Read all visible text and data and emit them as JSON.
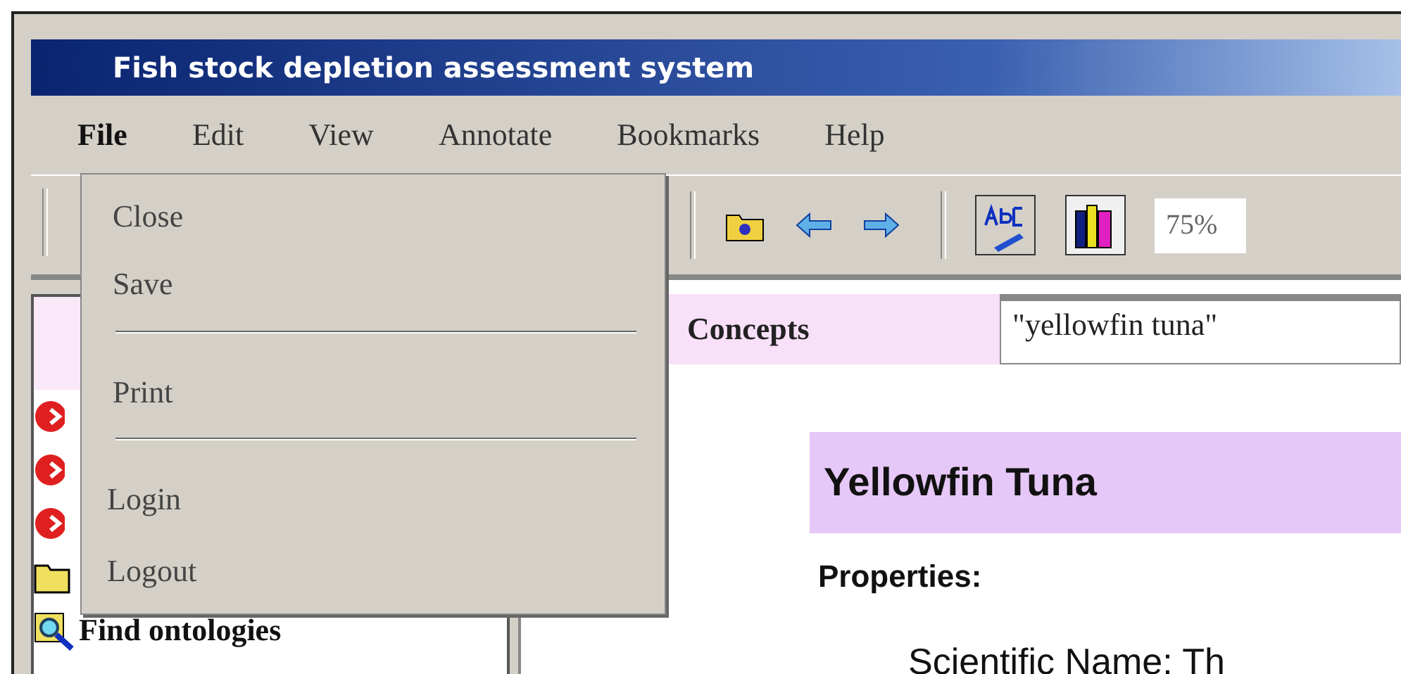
{
  "window": {
    "title": "Fish stock depletion assessment system"
  },
  "menu_bar": [
    {
      "label": "File",
      "open": true
    },
    {
      "label": "Edit",
      "open": false
    },
    {
      "label": "View",
      "open": false
    },
    {
      "label": "Annotate",
      "open": false
    },
    {
      "label": "Bookmarks",
      "open": false
    },
    {
      "label": "Help",
      "open": false
    }
  ],
  "file_menu": [
    {
      "kind": "item",
      "label": "Close"
    },
    {
      "kind": "item",
      "label": "Save"
    },
    {
      "kind": "separator"
    },
    {
      "kind": "item",
      "label": "Print"
    },
    {
      "kind": "separator"
    },
    {
      "kind": "item",
      "label": "Login"
    },
    {
      "kind": "item",
      "label": "Logout"
    }
  ],
  "toolbar": {
    "zoom": "75%"
  },
  "sidebar": {
    "items": [
      {
        "kind": "concept"
      },
      {
        "kind": "concept"
      },
      {
        "kind": "concept"
      },
      {
        "kind": "folder"
      },
      {
        "kind": "search",
        "label": "Find ontologies"
      }
    ]
  },
  "content": {
    "section_label": "Concepts",
    "query": "\"yellowfin tuna\"",
    "heading": "Yellowfin Tuna",
    "subheading": "Properties:",
    "property": "Scientific Name: Th"
  }
}
